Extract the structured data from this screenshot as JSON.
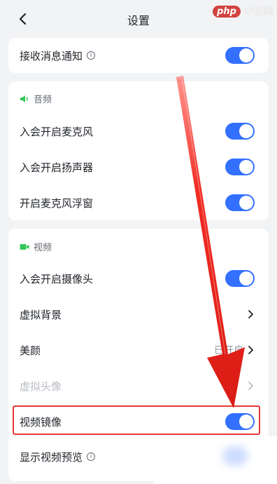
{
  "watermark": {
    "logo": "php",
    "text": "中文网"
  },
  "header": {
    "title": "设置"
  },
  "card1": {
    "notify": {
      "label": "接收消息通知",
      "info": "i",
      "toggle_on": true
    }
  },
  "audio": {
    "section": "音频",
    "items": [
      {
        "label": "入会开启麦克风",
        "toggle_on": true
      },
      {
        "label": "入会开启扬声器",
        "toggle_on": true
      },
      {
        "label": "开启麦克风浮窗",
        "toggle_on": true
      }
    ]
  },
  "video": {
    "section": "视频",
    "camera": {
      "label": "入会开启摄像头",
      "toggle_on": true
    },
    "virtual_bg": {
      "label": "虚拟背景"
    },
    "beauty": {
      "label": "美颜",
      "value": "已开启"
    },
    "virtual_avatar": {
      "label": "虚拟头像"
    },
    "mirror": {
      "label": "视频镜像",
      "toggle_on": true
    },
    "preview": {
      "label": "显示视频预览",
      "info": "i"
    }
  },
  "colors": {
    "accent": "#3370ff",
    "annotation": "#e53935"
  }
}
